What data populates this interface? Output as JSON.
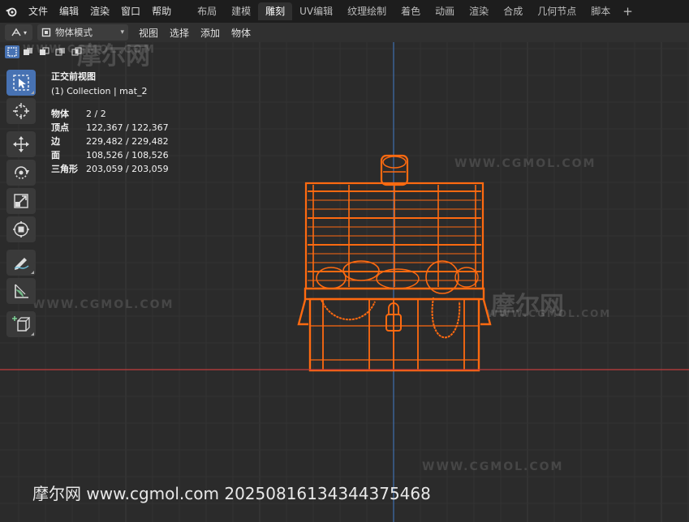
{
  "topbar": {
    "menus": [
      "文件",
      "编辑",
      "渲染",
      "窗口",
      "帮助"
    ],
    "workspaces": [
      {
        "label": "布局",
        "active": false
      },
      {
        "label": "建模",
        "active": false
      },
      {
        "label": "雕刻",
        "active": true
      },
      {
        "label": "UV编辑",
        "active": false
      },
      {
        "label": "纹理绘制",
        "active": false
      },
      {
        "label": "着色",
        "active": false
      },
      {
        "label": "动画",
        "active": false
      },
      {
        "label": "渲染",
        "active": false
      },
      {
        "label": "合成",
        "active": false
      },
      {
        "label": "几何节点",
        "active": false
      },
      {
        "label": "脚本",
        "active": false
      }
    ],
    "add_label": "+"
  },
  "header": {
    "mode": "物体模式",
    "menus": [
      "视图",
      "选择",
      "添加",
      "物体"
    ]
  },
  "viewport": {
    "view_name": "正交前视图",
    "collection": "(1) Collection | mat_2",
    "stats": [
      {
        "label": "物体",
        "value": "2 / 2"
      },
      {
        "label": "顶点",
        "value": "122,367 / 122,367"
      },
      {
        "label": "边",
        "value": "229,482 / 229,482"
      },
      {
        "label": "面",
        "value": "108,526 / 108,526"
      },
      {
        "label": "三角形",
        "value": "203,059 / 203,059"
      }
    ],
    "watermark_text": "WWW.CGMOL.COM",
    "watermark_logo": "摩尔网"
  },
  "footer_watermark": "摩尔网 www.cgmol.com 20250816134344375468",
  "colors": {
    "wireframe": "#ff6a10",
    "x_axis": "#c43c3c",
    "z_axis": "#3f6fb0",
    "active_tool": "#4772b3"
  },
  "toolbar_icons": [
    "select-box-icon",
    "cursor-icon",
    "move-icon",
    "rotate-icon",
    "scale-icon",
    "transform-icon",
    "annotate-icon",
    "measure-icon",
    "add-cube-icon"
  ]
}
